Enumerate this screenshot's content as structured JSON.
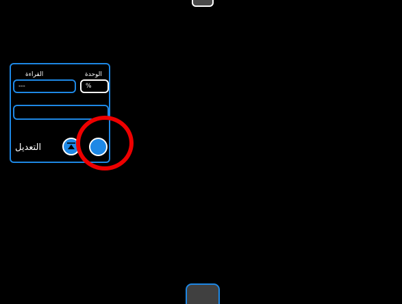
{
  "panel": {
    "reading_label": "القراءة",
    "unit_label": "الوحدة",
    "reading_value": "---",
    "unit_value": "%",
    "wide_field_value": "",
    "adjust_label": "التعديل"
  },
  "icons": {
    "step_button": "up-arrow-icon",
    "toggle_button": "circle-icon"
  },
  "colors": {
    "accent": "#1e88e5",
    "background": "#000000",
    "text": "#ffffff",
    "highlight": "#ee0000",
    "tab_fill": "#404040"
  }
}
